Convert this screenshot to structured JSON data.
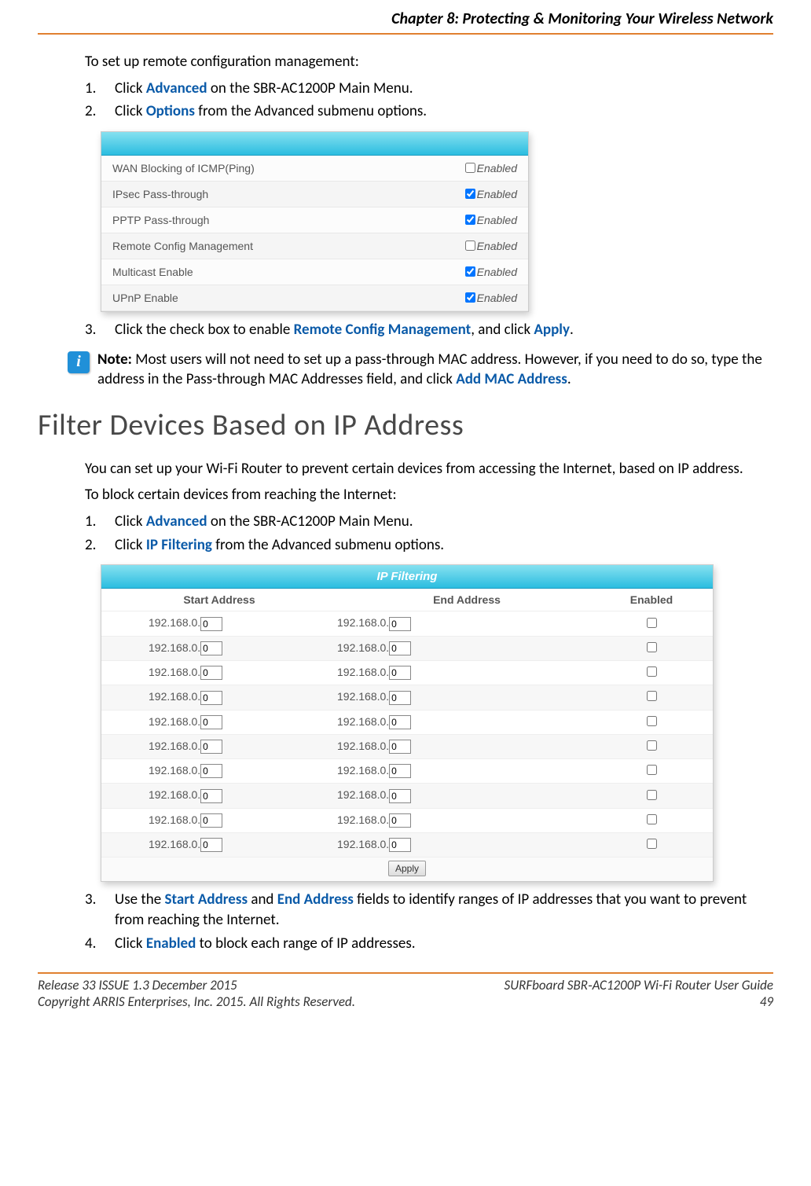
{
  "header": {
    "chapter": "Chapter 8: Protecting & Monitoring Your Wireless Network"
  },
  "section1": {
    "intro": "To set up remote configuration management:",
    "steps": [
      {
        "pre": "Click ",
        "link": "Advanced",
        "post": " on the SBR-AC1200P Main Menu."
      },
      {
        "pre": "Click ",
        "link": "Options",
        "post": " from the Advanced submenu options."
      }
    ],
    "step3": {
      "a": "Click the check box to enable ",
      "b": "Remote Config Management",
      "c": ", and click ",
      "d": "Apply",
      "e": "."
    },
    "note": {
      "label": "Note:",
      "a": " Most users will not need to set up a pass-through MAC address.  However, if you need to do so, type the address in the Pass-through MAC Addresses field, and click ",
      "b": "Add MAC Address",
      "c": "."
    },
    "icon_glyph": "i"
  },
  "options_table": {
    "enabled_label": "Enabled",
    "rows": [
      {
        "label": "WAN Blocking of ICMP(Ping)",
        "checked": false
      },
      {
        "label": "IPsec Pass-through",
        "checked": true
      },
      {
        "label": "PPTP Pass-through",
        "checked": true
      },
      {
        "label": "Remote Config Management",
        "checked": false
      },
      {
        "label": "Multicast Enable",
        "checked": true
      },
      {
        "label": "UPnP Enable",
        "checked": true
      }
    ]
  },
  "section2": {
    "title": "Filter Devices Based on IP Address",
    "p1": "You can set up your Wi-Fi Router to prevent certain devices from accessing the Internet, based on IP address.",
    "p2": "To block certain devices from reaching the Internet:",
    "steps": [
      {
        "pre": "Click ",
        "link": "Advanced",
        "post": " on the SBR-AC1200P Main Menu."
      },
      {
        "pre": "Click ",
        "link": "IP Filtering",
        "post": " from the Advanced submenu options."
      }
    ],
    "step3": {
      "a": "Use the ",
      "b": "Start Address",
      "c": " and ",
      "d": "End Address",
      "e": " fields to identify ranges of IP addresses that you want to prevent from reaching the Internet."
    },
    "step4": {
      "a": "Click ",
      "b": "Enabled",
      "c": " to block each range of IP addresses."
    }
  },
  "ip_table": {
    "title": "IP Filtering",
    "col1": "Start Address",
    "col2": "End Address",
    "col3": "Enabled",
    "ip_prefix": "192.168.0.",
    "default_octet": "0",
    "apply": "Apply",
    "row_count": 10
  },
  "footer": {
    "l1": "Release 33 ISSUE 1.3    December 2015",
    "l2": "Copyright ARRIS Enterprises, Inc. 2015. All Rights Reserved.",
    "r1": "SURFboard SBR‑AC1200P Wi-Fi Router User Guide",
    "r2": "49"
  }
}
